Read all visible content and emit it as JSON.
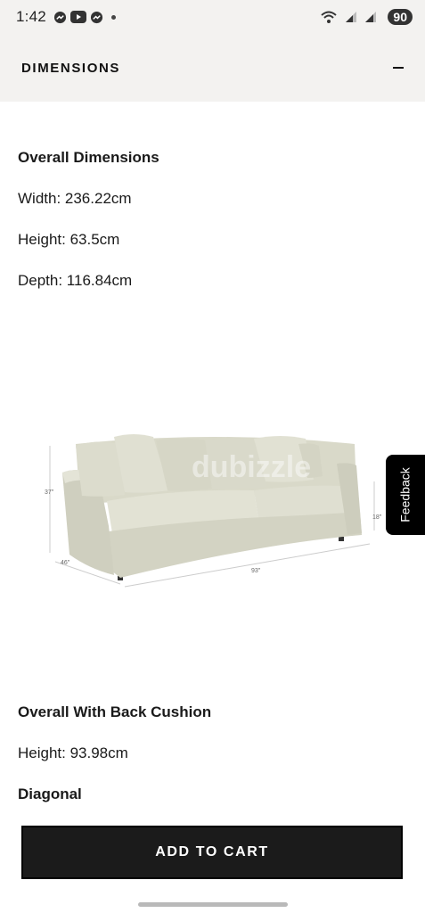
{
  "status_bar": {
    "time": "1:42",
    "battery": "90",
    "icons": [
      "messenger-icon",
      "youtube-icon",
      "messenger-icon",
      "wifi-icon",
      "signal-icon",
      "signal-icon"
    ]
  },
  "accordion": {
    "title": "DIMENSIONS",
    "toggle": "−"
  },
  "overall_dimensions": {
    "heading": "Overall Dimensions",
    "width": "Width: 236.22cm",
    "height": "Height: 63.5cm",
    "depth": "Depth: 116.84cm"
  },
  "image": {
    "watermark": "dubizzle",
    "labels": {
      "height_back": "37\"",
      "seat_height": "18\"",
      "depth": "46\"",
      "width": "93\""
    }
  },
  "back_cushion": {
    "heading": "Overall With Back Cushion",
    "height": "Height: 93.98cm"
  },
  "diagonal": {
    "heading": "Diagonal"
  },
  "feedback": {
    "label": "Feedback"
  },
  "cta": {
    "label": "ADD TO CART"
  },
  "colors": {
    "header_bg": "#f3f2f0",
    "button_bg": "#1b1b1b",
    "sofa": "#dcdcce"
  }
}
